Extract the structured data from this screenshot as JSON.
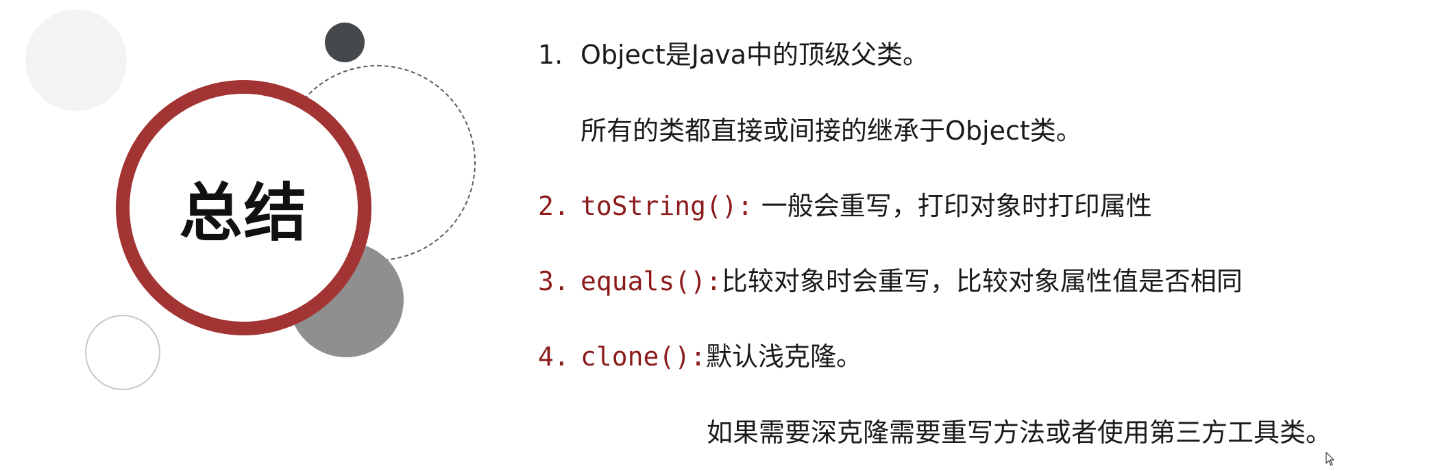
{
  "title": "总结",
  "points": [
    {
      "number": "1.",
      "text": "Object是Java中的顶级父类。",
      "continuation": "所有的类都直接或间接的继承于Object类。"
    },
    {
      "number": "2.",
      "method": "toString():",
      "text": " 一般会重写，打印对象时打印属性"
    },
    {
      "number": "3.",
      "method": "equals():",
      "text": "比较对象时会重写，比较对象属性值是否相同"
    },
    {
      "number": "4.",
      "method": "clone():",
      "text": "默认浅克隆。",
      "continuation": "如果需要深克隆需要重写方法或者使用第三方工具类。"
    }
  ],
  "colors": {
    "accent": "#a33434",
    "code": "#8c1b1b",
    "dark_dot": "#46494c",
    "gray_circle": "#8f8f8f"
  },
  "icons": [
    "mouse-cursor-icon"
  ]
}
